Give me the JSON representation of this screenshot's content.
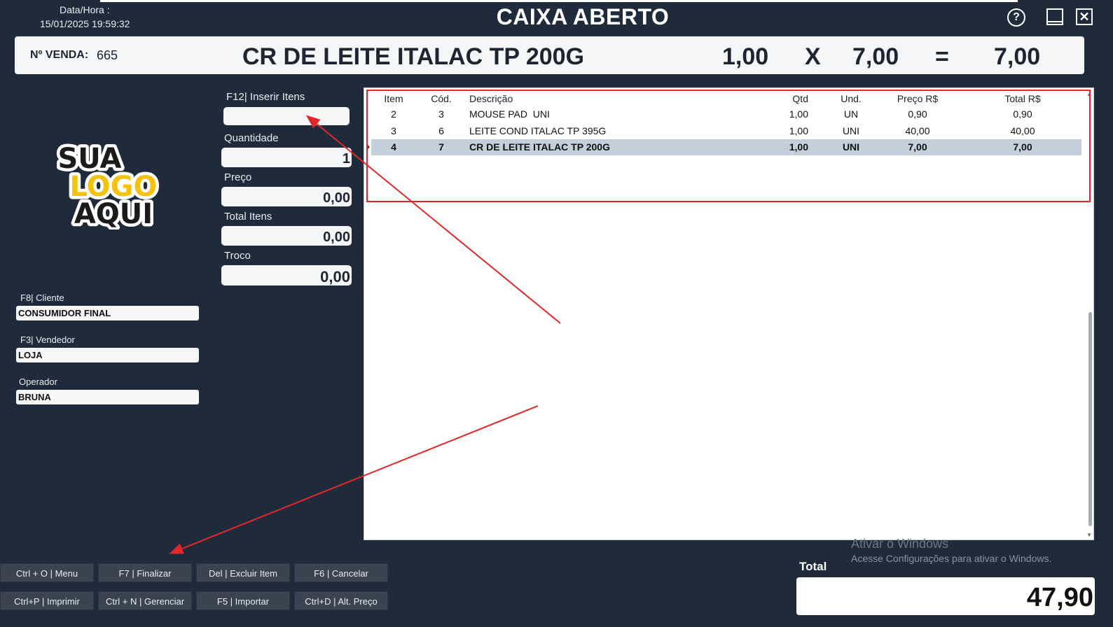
{
  "header": {
    "datetime_label": "Data/Hora :",
    "datetime_value": "15/01/2025 19:59:32",
    "title": "CAIXA ABERTO",
    "help_glyph": "?",
    "close_glyph": "✕"
  },
  "banner": {
    "venda_label": "Nº VENDA:",
    "venda_number": "665",
    "product": "CR DE LEITE ITALAC TP 200G",
    "quantity": "1,00",
    "times": "X",
    "price": "7,00",
    "equals": "=",
    "total": "7,00"
  },
  "logo": {
    "line1": "SUA",
    "line2": "LOGO",
    "line3": "AQUI"
  },
  "entry": {
    "inserir_label": "F12| Inserir Itens",
    "inserir_value": "",
    "quantidade_label": "Quantidade",
    "quantidade_value": "1",
    "preco_label": "Preço",
    "preco_value": "0,00",
    "total_itens_label": "Total Itens",
    "total_itens_value": "0,00",
    "troco_label": "Troco",
    "troco_value": "0,00"
  },
  "side": {
    "cliente_label": "F8| Cliente",
    "cliente_value": "CONSUMIDOR FINAL",
    "vendedor_label": "F3| Vendedor",
    "vendedor_value": "LOJA",
    "operador_label": "Operador",
    "operador_value": "BRUNA"
  },
  "grid": {
    "columns": [
      "Item",
      "Cód.",
      "Descrição",
      "Qtd",
      "Und.",
      "Preço R$",
      "Total R$"
    ],
    "rows": [
      [
        "2",
        "3",
        "MOUSE PAD  UNI",
        "1,00",
        "UN",
        "0,90",
        "0,90"
      ],
      [
        "3",
        "6",
        "LEITE COND ITALAC TP 395G",
        "1,00",
        "UNI",
        "40,00",
        "40,00"
      ],
      [
        "4",
        "7",
        "CR DE LEITE ITALAC TP 200G",
        "1,00",
        "UNI",
        "7,00",
        "7,00"
      ]
    ],
    "selected_row": 2
  },
  "buttons": {
    "menu": "Ctrl + O | Menu",
    "finalizar": "F7 | Finalizar",
    "excluir": "Del | Excluir Item",
    "cancelar": "F6 | Cancelar",
    "imprimir": "Ctrl+P | Imprimir",
    "gerenciar": "Ctrl + N | Gerenciar",
    "importar": "F5 | Importar",
    "alt_preco": "Ctrl+D | Alt. Preço"
  },
  "watermark": {
    "line1": "Ativar o Windows",
    "line2": "Acesse Configurações para ativar o Windows."
  },
  "footer": {
    "total_label": "Total",
    "total_value": "47,90"
  },
  "colors": {
    "background": "#1f2b3a",
    "annotation": "#e32626",
    "selected_row": "#c4cfdc"
  }
}
